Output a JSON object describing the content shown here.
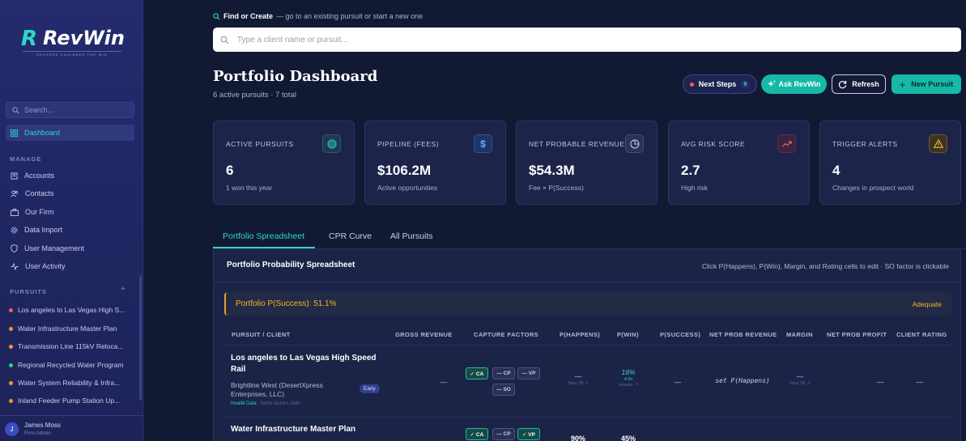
{
  "brand": {
    "name": "RevWin",
    "tagline": "REVERSE ENGINEER THE WIN"
  },
  "sidebar": {
    "search_placeholder": "Search...",
    "dashboard": "Dashboard",
    "manage_title": "MANAGE",
    "manage_items": [
      "Accounts",
      "Contacts",
      "Our Firm",
      "Data Import",
      "User Management",
      "User Activity"
    ],
    "pursuits_title": "PURSUITS",
    "pursuits": [
      {
        "label": "Los angeles to Las Vegas High S...",
        "color": "#ff5a5a"
      },
      {
        "label": "Water Infrastructure Master Plan",
        "color": "#f0962e"
      },
      {
        "label": "Transmission Line 115kV Reloca...",
        "color": "#f0962e"
      },
      {
        "label": "Regional Recycled Water Program",
        "color": "#2fd67a"
      },
      {
        "label": "Water System Reliability & Infra...",
        "color": "#f0962e"
      },
      {
        "label": "Inland Feeder Pump Station Up...",
        "color": "#f0962e"
      }
    ],
    "user": {
      "initial": "J",
      "name": "James Moss",
      "role": "Firm Admin"
    }
  },
  "find": {
    "title": "Find or Create",
    "desc": "— go to an existing pursuit or start a new one",
    "placeholder": "Type a client name or pursuit..."
  },
  "header": {
    "title": "Portfolio Dashboard",
    "subtitle": "6 active pursuits · 7 total",
    "next_steps": "Next Steps",
    "next_steps_count": "9",
    "ask": "Ask RevWin",
    "refresh": "Refresh",
    "new_pursuit": "New Pursuit"
  },
  "kpis": [
    {
      "label": "ACTIVE PURSUITS",
      "value": "6",
      "sub": "1 won this year",
      "icon": "target-icon",
      "color": "#2fd6c8"
    },
    {
      "label": "PIPELINE (FEES)",
      "value": "$106.2M",
      "sub": "Active opportunities",
      "icon": "dollar-icon",
      "color": "#6ea8ff"
    },
    {
      "label": "NET PROBABLE REVENUE",
      "value": "$54.3M",
      "sub": "Fee × P(Success)",
      "icon": "pie-icon",
      "color": "#c9cdf0"
    },
    {
      "label": "AVG RISK SCORE",
      "value": "2.7",
      "sub": "High risk",
      "icon": "trend-up-icon",
      "color": "#ff5a6e"
    },
    {
      "label": "TRIGGER ALERTS",
      "value": "4",
      "sub": "Changes in prospect world",
      "icon": "alert-icon",
      "color": "#f1b52b"
    }
  ],
  "tabs": [
    "Portfolio Spreadsheet",
    "CPR Curve",
    "All Pursuits"
  ],
  "sheet": {
    "title": "Portfolio Probability Spreadsheet",
    "hint": "Click P(Happens), P(Win), Margin, and Rating cells to edit · SO factor is clickable",
    "psuccess": "Portfolio P(Success): 51.1%",
    "psuccess_rating": "Adequate",
    "columns": [
      "PURSUIT / CLIENT",
      "GROSS REVENUE",
      "CAPTURE FACTORS",
      "P(HAPPENS)",
      "P(WIN)",
      "P(SUCCESS)",
      "NET PROB REVENUE",
      "MARGIN",
      "NET PROB PROFIT",
      "CLIENT RATING"
    ],
    "rows": [
      {
        "title_1": "Los angeles to Las Vegas High Speed",
        "title_2": "Rail",
        "client_1": "Brightline West (DesertXpress",
        "client_2": "Enterprises, LLC)",
        "stage": "Early",
        "note": "Invalid Data",
        "note_2": "Some factors stale",
        "gross": "—",
        "factors": [
          "✓ CA",
          "— CP",
          "— VP",
          "— SO"
        ],
        "phappens": "—",
        "phappens_sub": "Step 2B ↗",
        "pwin": "18%",
        "pwin_2": "4.5x",
        "pwin_sub": "Header ↗",
        "psuccess": "—",
        "netprob": "set P(Happens)",
        "margin": "—",
        "margin_sub": "Step 2B ↗",
        "netprofit": "—",
        "rating": "—"
      },
      {
        "title_1": "Water Infrastructure Master Plan",
        "factors": [
          "✓ CA",
          "— CP",
          "✓ VP"
        ],
        "phappens": "90%",
        "pwin": "45%"
      }
    ]
  }
}
